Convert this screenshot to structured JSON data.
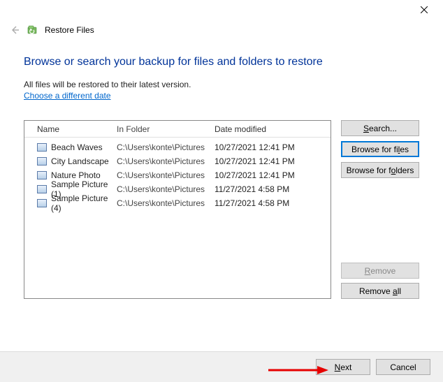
{
  "window_title": "Restore Files",
  "heading": "Browse or search your backup for files and folders to restore",
  "subtext": "All files will be restored to their latest version.",
  "change_date_link": "Choose a different date",
  "columns": {
    "name": "Name",
    "folder": "In Folder",
    "date": "Date modified"
  },
  "files": [
    {
      "name": "Beach Waves",
      "folder": "C:\\Users\\konte\\Pictures",
      "date": "10/27/2021 12:41 PM"
    },
    {
      "name": "City Landscape",
      "folder": "C:\\Users\\konte\\Pictures",
      "date": "10/27/2021 12:41 PM"
    },
    {
      "name": "Nature Photo",
      "folder": "C:\\Users\\konte\\Pictures",
      "date": "10/27/2021 12:41 PM"
    },
    {
      "name": "Sample Picture (1)",
      "folder": "C:\\Users\\konte\\Pictures",
      "date": "11/27/2021 4:58 PM"
    },
    {
      "name": "Sample Picture (4)",
      "folder": "C:\\Users\\konte\\Pictures",
      "date": "11/27/2021 4:58 PM"
    }
  ],
  "buttons": {
    "search": "Search...",
    "browse_files": "Browse for files",
    "browse_folders": "Browse for folders",
    "remove": "Remove",
    "remove_all": "Remove all",
    "next": "Next",
    "cancel": "Cancel"
  }
}
